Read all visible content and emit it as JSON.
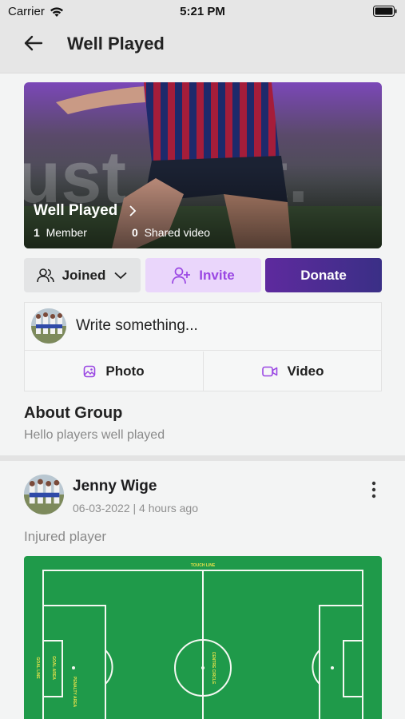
{
  "status_bar": {
    "carrier": "Carrier",
    "time": "5:21 PM"
  },
  "header": {
    "title": "Well Played",
    "back_icon": "arrow-left-icon"
  },
  "group": {
    "name": "Well Played",
    "member_count": "1",
    "member_label": "Member",
    "shared_video_count": "0",
    "shared_video_label": "Shared video"
  },
  "actions": {
    "joined_label": "Joined",
    "invite_label": "Invite",
    "donate_label": "Donate"
  },
  "composer": {
    "placeholder": "Write something...",
    "photo_label": "Photo",
    "video_label": "Video"
  },
  "about": {
    "title": "About Group",
    "description": "Hello players well played"
  },
  "post": {
    "author": "Jenny Wige",
    "meta": "06-03-2022 | 4 hours ago",
    "text": "Injured player",
    "pitch_labels": [
      "TOUCH LINE",
      "GOAL LINE",
      "GOAL AREA",
      "PENALTY AREA",
      "CENTRE CIRCLE"
    ]
  },
  "colors": {
    "accent": "#9a47e3",
    "donate_start": "#5e2a9e",
    "donate_end": "#3a2f86",
    "pitch": "#1f9a4a"
  }
}
